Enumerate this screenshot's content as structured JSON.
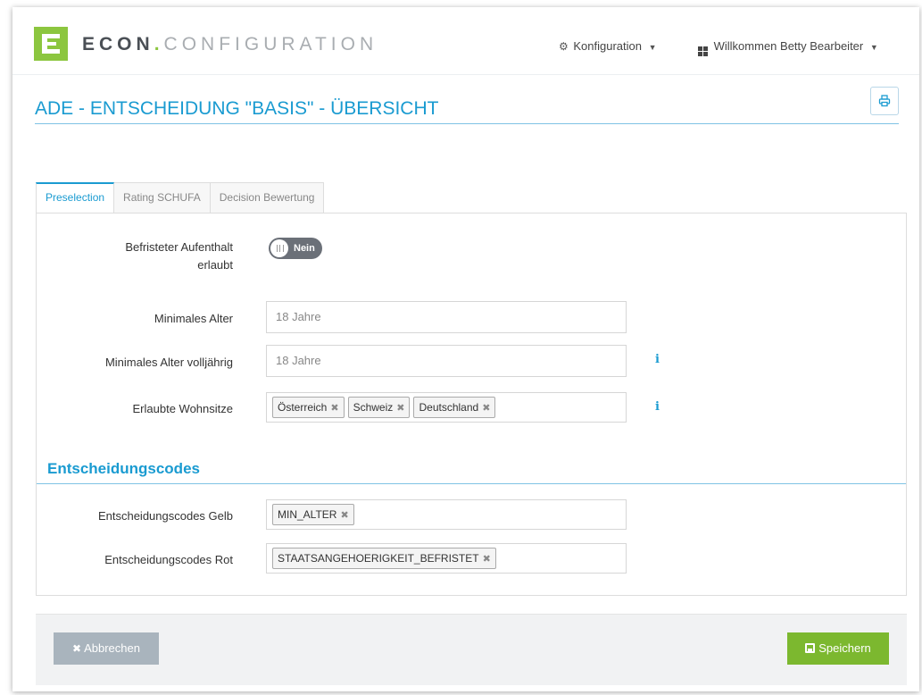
{
  "header": {
    "brand_primary": "ECON",
    "brand_dot": ".",
    "brand_secondary": "CONFIGURATION",
    "config_menu": "Konfiguration",
    "user_menu": "Willkommen Betty Bearbeiter",
    "brand_color": "#8cc63f"
  },
  "page": {
    "title": "ADE - ENTSCHEIDUNG \"BASIS\" - ÜBERSICHT",
    "print_icon": "print-icon",
    "accent_color": "#1a9bd1"
  },
  "tabs": [
    {
      "label": "Preselection",
      "active": true
    },
    {
      "label": "Rating SCHUFA",
      "active": false
    },
    {
      "label": "Decision Bewertung",
      "active": false
    }
  ],
  "form": {
    "befristet": {
      "label_line1": "Befristeter Aufenthalt",
      "label_line2": "erlaubt",
      "toggle_text": "Nein",
      "value": false
    },
    "min_alter": {
      "label": "Minimales Alter",
      "placeholder": "18 Jahre"
    },
    "min_alter_volljaehrig": {
      "label": "Minimales Alter volljährig",
      "placeholder": "18 Jahre",
      "info_icon": "info-icon"
    },
    "wohnsitze": {
      "label": "Erlaubte Wohnsitze",
      "tags": [
        "Österreich",
        "Schweiz",
        "Deutschland"
      ],
      "info_icon": "info-icon"
    }
  },
  "codes": {
    "section_title": "Entscheidungscodes",
    "gelb": {
      "label": "Entscheidungscodes Gelb",
      "tags": [
        "MIN_ALTER"
      ]
    },
    "rot": {
      "label": "Entscheidungscodes Rot",
      "tags": [
        "STAATSANGEHOERIGKEIT_BEFRISTET"
      ]
    }
  },
  "footer": {
    "cancel_label": "Abbrechen",
    "save_label": "Speichern",
    "cancel_color": "#a9b4bd",
    "save_color": "#7cb82f"
  }
}
